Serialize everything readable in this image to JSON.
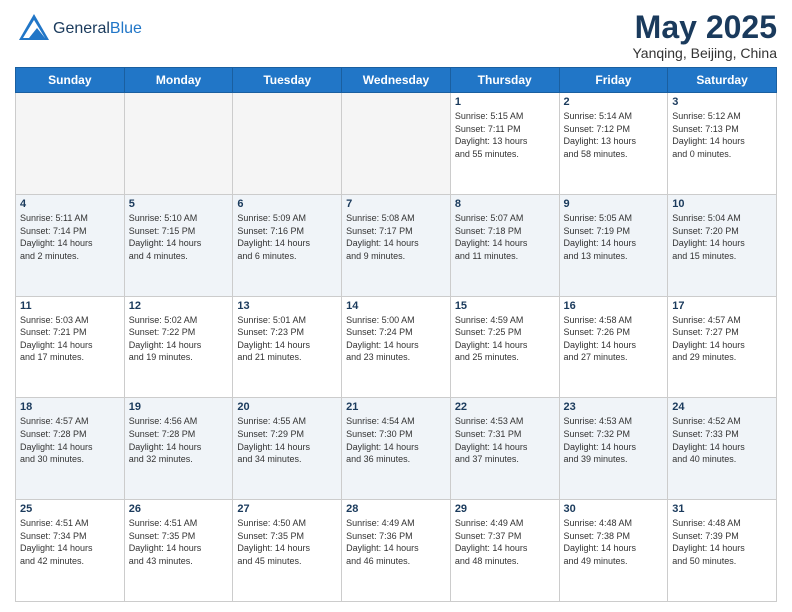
{
  "header": {
    "logo_general": "General",
    "logo_blue": "Blue",
    "month_title": "May 2025",
    "subtitle": "Yanqing, Beijing, China"
  },
  "days_of_week": [
    "Sunday",
    "Monday",
    "Tuesday",
    "Wednesday",
    "Thursday",
    "Friday",
    "Saturday"
  ],
  "weeks": [
    [
      {
        "day": "",
        "info": ""
      },
      {
        "day": "",
        "info": ""
      },
      {
        "day": "",
        "info": ""
      },
      {
        "day": "",
        "info": ""
      },
      {
        "day": "1",
        "info": "Sunrise: 5:15 AM\nSunset: 7:11 PM\nDaylight: 13 hours\nand 55 minutes."
      },
      {
        "day": "2",
        "info": "Sunrise: 5:14 AM\nSunset: 7:12 PM\nDaylight: 13 hours\nand 58 minutes."
      },
      {
        "day": "3",
        "info": "Sunrise: 5:12 AM\nSunset: 7:13 PM\nDaylight: 14 hours\nand 0 minutes."
      }
    ],
    [
      {
        "day": "4",
        "info": "Sunrise: 5:11 AM\nSunset: 7:14 PM\nDaylight: 14 hours\nand 2 minutes."
      },
      {
        "day": "5",
        "info": "Sunrise: 5:10 AM\nSunset: 7:15 PM\nDaylight: 14 hours\nand 4 minutes."
      },
      {
        "day": "6",
        "info": "Sunrise: 5:09 AM\nSunset: 7:16 PM\nDaylight: 14 hours\nand 6 minutes."
      },
      {
        "day": "7",
        "info": "Sunrise: 5:08 AM\nSunset: 7:17 PM\nDaylight: 14 hours\nand 9 minutes."
      },
      {
        "day": "8",
        "info": "Sunrise: 5:07 AM\nSunset: 7:18 PM\nDaylight: 14 hours\nand 11 minutes."
      },
      {
        "day": "9",
        "info": "Sunrise: 5:05 AM\nSunset: 7:19 PM\nDaylight: 14 hours\nand 13 minutes."
      },
      {
        "day": "10",
        "info": "Sunrise: 5:04 AM\nSunset: 7:20 PM\nDaylight: 14 hours\nand 15 minutes."
      }
    ],
    [
      {
        "day": "11",
        "info": "Sunrise: 5:03 AM\nSunset: 7:21 PM\nDaylight: 14 hours\nand 17 minutes."
      },
      {
        "day": "12",
        "info": "Sunrise: 5:02 AM\nSunset: 7:22 PM\nDaylight: 14 hours\nand 19 minutes."
      },
      {
        "day": "13",
        "info": "Sunrise: 5:01 AM\nSunset: 7:23 PM\nDaylight: 14 hours\nand 21 minutes."
      },
      {
        "day": "14",
        "info": "Sunrise: 5:00 AM\nSunset: 7:24 PM\nDaylight: 14 hours\nand 23 minutes."
      },
      {
        "day": "15",
        "info": "Sunrise: 4:59 AM\nSunset: 7:25 PM\nDaylight: 14 hours\nand 25 minutes."
      },
      {
        "day": "16",
        "info": "Sunrise: 4:58 AM\nSunset: 7:26 PM\nDaylight: 14 hours\nand 27 minutes."
      },
      {
        "day": "17",
        "info": "Sunrise: 4:57 AM\nSunset: 7:27 PM\nDaylight: 14 hours\nand 29 minutes."
      }
    ],
    [
      {
        "day": "18",
        "info": "Sunrise: 4:57 AM\nSunset: 7:28 PM\nDaylight: 14 hours\nand 30 minutes."
      },
      {
        "day": "19",
        "info": "Sunrise: 4:56 AM\nSunset: 7:28 PM\nDaylight: 14 hours\nand 32 minutes."
      },
      {
        "day": "20",
        "info": "Sunrise: 4:55 AM\nSunset: 7:29 PM\nDaylight: 14 hours\nand 34 minutes."
      },
      {
        "day": "21",
        "info": "Sunrise: 4:54 AM\nSunset: 7:30 PM\nDaylight: 14 hours\nand 36 minutes."
      },
      {
        "day": "22",
        "info": "Sunrise: 4:53 AM\nSunset: 7:31 PM\nDaylight: 14 hours\nand 37 minutes."
      },
      {
        "day": "23",
        "info": "Sunrise: 4:53 AM\nSunset: 7:32 PM\nDaylight: 14 hours\nand 39 minutes."
      },
      {
        "day": "24",
        "info": "Sunrise: 4:52 AM\nSunset: 7:33 PM\nDaylight: 14 hours\nand 40 minutes."
      }
    ],
    [
      {
        "day": "25",
        "info": "Sunrise: 4:51 AM\nSunset: 7:34 PM\nDaylight: 14 hours\nand 42 minutes."
      },
      {
        "day": "26",
        "info": "Sunrise: 4:51 AM\nSunset: 7:35 PM\nDaylight: 14 hours\nand 43 minutes."
      },
      {
        "day": "27",
        "info": "Sunrise: 4:50 AM\nSunset: 7:35 PM\nDaylight: 14 hours\nand 45 minutes."
      },
      {
        "day": "28",
        "info": "Sunrise: 4:49 AM\nSunset: 7:36 PM\nDaylight: 14 hours\nand 46 minutes."
      },
      {
        "day": "29",
        "info": "Sunrise: 4:49 AM\nSunset: 7:37 PM\nDaylight: 14 hours\nand 48 minutes."
      },
      {
        "day": "30",
        "info": "Sunrise: 4:48 AM\nSunset: 7:38 PM\nDaylight: 14 hours\nand 49 minutes."
      },
      {
        "day": "31",
        "info": "Sunrise: 4:48 AM\nSunset: 7:39 PM\nDaylight: 14 hours\nand 50 minutes."
      }
    ]
  ]
}
